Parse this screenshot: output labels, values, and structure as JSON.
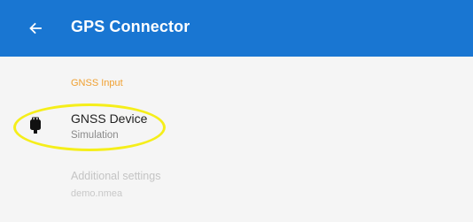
{
  "app_bar": {
    "title": "GPS Connector",
    "background": "#1976d2",
    "back_icon": "arrow-back-icon"
  },
  "section": {
    "header": "GNSS Input",
    "header_color": "#f0a030"
  },
  "preferences": [
    {
      "title": "GNSS Device",
      "summary": "Simulation",
      "icon": "gnss-device-icon",
      "enabled": true
    },
    {
      "title": "Additional settings",
      "summary": "demo.nmea",
      "enabled": false
    }
  ],
  "annotation": {
    "color": "#f5ee1a",
    "shape": "ellipse"
  }
}
